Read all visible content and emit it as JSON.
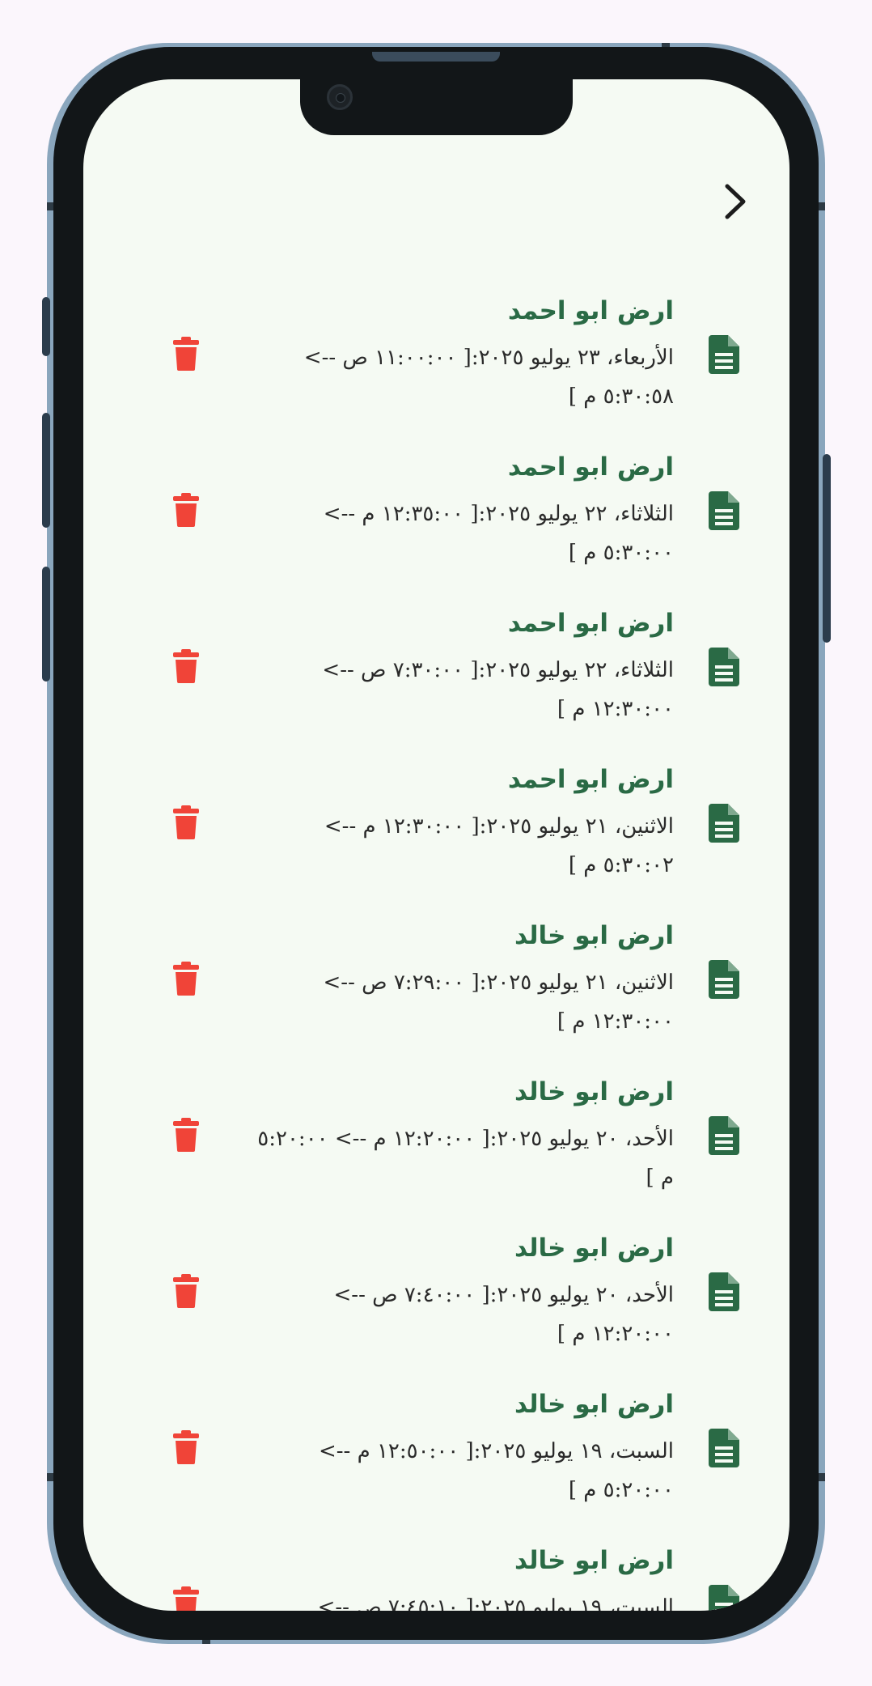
{
  "header": {
    "back_icon": "chevron-right-icon"
  },
  "colors": {
    "title_green": "#2a6a45",
    "delete_red": "#f04438",
    "screen_bg": "#f5faf3"
  },
  "entries": [
    {
      "title": "ارض ابو احمد",
      "details": "الأربعاء، ٢٣ يوليو ٢٠٢٥:[ ١١:٠٠:٠٠ ص --> ٥:٣٠:٥٨ م ]"
    },
    {
      "title": "ارض ابو احمد",
      "details": "الثلاثاء، ٢٢ يوليو ٢٠٢٥:[ ١٢:٣٥:٠٠ م --> ٥:٣٠:٠٠ م ]"
    },
    {
      "title": "ارض ابو احمد",
      "details": "الثلاثاء، ٢٢ يوليو ٢٠٢٥:[ ٧:٣٠:٠٠ ص --> ١٢:٣٠:٠٠ م ]"
    },
    {
      "title": "ارض ابو احمد",
      "details": "الاثنين، ٢١ يوليو ٢٠٢٥:[ ١٢:٣٠:٠٠ م --> ٥:٣٠:٠٢ م ]"
    },
    {
      "title": "ارض ابو خالد",
      "details": "الاثنين، ٢١ يوليو ٢٠٢٥:[ ٧:٢٩:٠٠ ص --> ١٢:٣٠:٠٠ م ]"
    },
    {
      "title": "ارض ابو خالد",
      "details": "الأحد، ٢٠ يوليو ٢٠٢٥:[ ١٢:٢٠:٠٠ م --> ٥:٢٠:٠٠ م ]"
    },
    {
      "title": "ارض ابو خالد",
      "details": "الأحد، ٢٠ يوليو ٢٠٢٥:[ ٧:٤٠:٠٠ ص --> ١٢:٢٠:٠٠ م ]"
    },
    {
      "title": "ارض ابو خالد",
      "details": "السبت، ١٩ يوليو ٢٠٢٥:[ ١٢:٥٠:٠٠ م --> ٥:٢٠:٠٠ م ]"
    },
    {
      "title": "ارض ابو خالد",
      "details": "السبت، ١٩ يوليو ٢٠٢٥:[ ٧:٤٥:١٠ ص -->"
    }
  ]
}
